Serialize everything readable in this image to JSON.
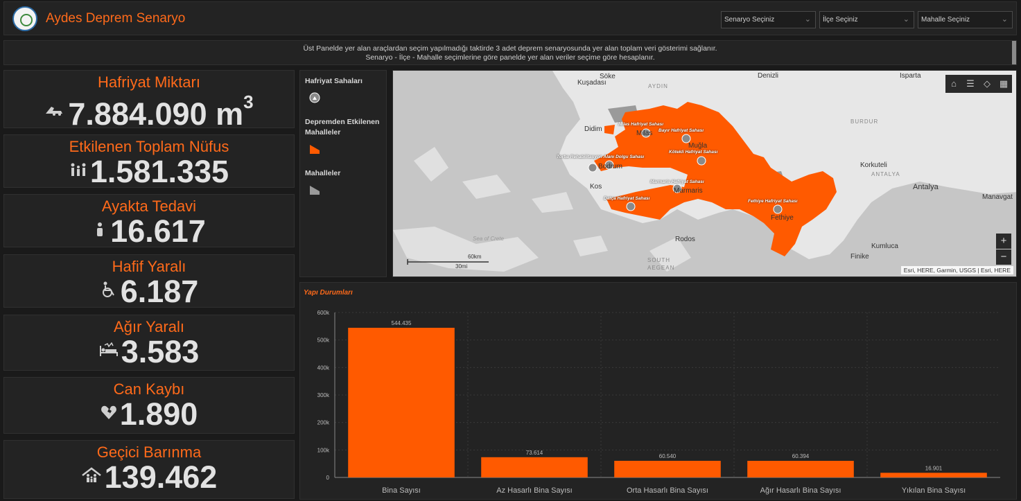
{
  "header": {
    "title": "Aydes Deprem Senaryo",
    "dropdowns": [
      {
        "label": "Senaryo Seçiniz"
      },
      {
        "label": "İlçe Seçiniz"
      },
      {
        "label": "Mahalle Seçiniz"
      }
    ]
  },
  "info": {
    "line1": "Üst Panelde yer alan araçlardan seçim yapılmadığı taktirde 3 adet deprem senaryosunda yer alan toplam veri gösterimi sağlanır.",
    "line2": "Senaryo - İlçe - Mahalle seçimlerine göre panelde yer alan veriler seçime göre hesaplanır."
  },
  "stats": [
    {
      "label": "Hafriyat Miktarı",
      "value": "7.884.090 m",
      "unit_sup": "3",
      "icon": "excavator-icon"
    },
    {
      "label": "Etkilenen Toplam Nüfus",
      "value": "1.581.335",
      "icon": "family-icon"
    },
    {
      "label": "Ayakta Tedavi",
      "value": "16.617",
      "icon": "outpatient-icon"
    },
    {
      "label": "Hafif Yaralı",
      "value": "6.187",
      "icon": "wheelchair-icon"
    },
    {
      "label": "Ağır Yaralı",
      "value": "3.583",
      "icon": "hospital-bed-icon"
    },
    {
      "label": "Can Kaybı",
      "value": "1.890",
      "icon": "broken-heart-icon"
    },
    {
      "label": "Geçici Barınma",
      "value": "139.462",
      "icon": "shelter-icon"
    }
  ],
  "legend": {
    "items": [
      {
        "title": "Hafriyat Sahaları",
        "symbol": "excavation-site-symbol"
      },
      {
        "title": "Depremden Etkilenen Mahalleler",
        "symbol": "affected-area-symbol",
        "color": "#ff5a00"
      },
      {
        "title": "Mahalleler",
        "symbol": "neighborhood-symbol",
        "color": "#9a9a9a"
      }
    ]
  },
  "map": {
    "places": [
      {
        "name": "Söke"
      },
      {
        "name": "Kuşadası"
      },
      {
        "name": "AYDIN",
        "kind": "region"
      },
      {
        "name": "Denizli"
      },
      {
        "name": "Isparta"
      },
      {
        "name": "BURDUR",
        "kind": "region"
      },
      {
        "name": "Didim"
      },
      {
        "name": "Milas"
      },
      {
        "name": "Muğla"
      },
      {
        "name": "Bodrum"
      },
      {
        "name": "Kos"
      },
      {
        "name": "Marmaris"
      },
      {
        "name": "Fethiye"
      },
      {
        "name": "Korkuteli"
      },
      {
        "name": "ANTALYA",
        "kind": "region"
      },
      {
        "name": "Antalya"
      },
      {
        "name": "Manavgat"
      },
      {
        "name": "Rodos"
      },
      {
        "name": "Kumluca"
      },
      {
        "name": "Finike"
      },
      {
        "name": "SOUTH",
        "kind": "region"
      },
      {
        "name": "AEGEAN",
        "kind": "region"
      },
      {
        "name": "Sea of Crete",
        "kind": "sea"
      }
    ],
    "sites": [
      {
        "name": "Milas Hafriyat Sahası"
      },
      {
        "name": "Bayır Hafriyat Sahası"
      },
      {
        "name": "Kötekli Hafriyat Sahası"
      },
      {
        "name": "Torba Rehabilitasyon Alanı Dolgu Sahası"
      },
      {
        "name": "Marmaris Hafriyat Sahası"
      },
      {
        "name": "Datça Hafriyat Sahası"
      },
      {
        "name": "Fethiye Hafriyat Sahası"
      }
    ],
    "scale_km": "60km",
    "scale_mi": "30mi",
    "attribution": "Esri, HERE, Garmin, USGS | Esri, HERE",
    "zoom_in": "+",
    "zoom_out": "−",
    "tools": [
      "home-icon",
      "list-icon",
      "layers-icon",
      "qr-icon"
    ]
  },
  "chart_data": {
    "type": "bar",
    "title": "Yapı Durumları",
    "categories": [
      "Bina Sayısı",
      "Az Hasarlı Bina Sayısı",
      "Orta Hasarlı Bina Sayısı",
      "Ağır Hasarlı Bina Sayısı",
      "Yıkılan Bina Sayısı"
    ],
    "values": [
      544435,
      73614,
      60540,
      60394,
      16901
    ],
    "value_labels": [
      "544.435",
      "73.614",
      "60.540",
      "60.394",
      "16.901"
    ],
    "ylim": [
      0,
      600000
    ],
    "yticks": [
      0,
      100000,
      200000,
      300000,
      400000,
      500000,
      600000
    ],
    "ytick_labels": [
      "0",
      "100k",
      "200k",
      "300k",
      "400k",
      "500k",
      "600k"
    ],
    "color": "#ff5a00",
    "grid": true
  }
}
